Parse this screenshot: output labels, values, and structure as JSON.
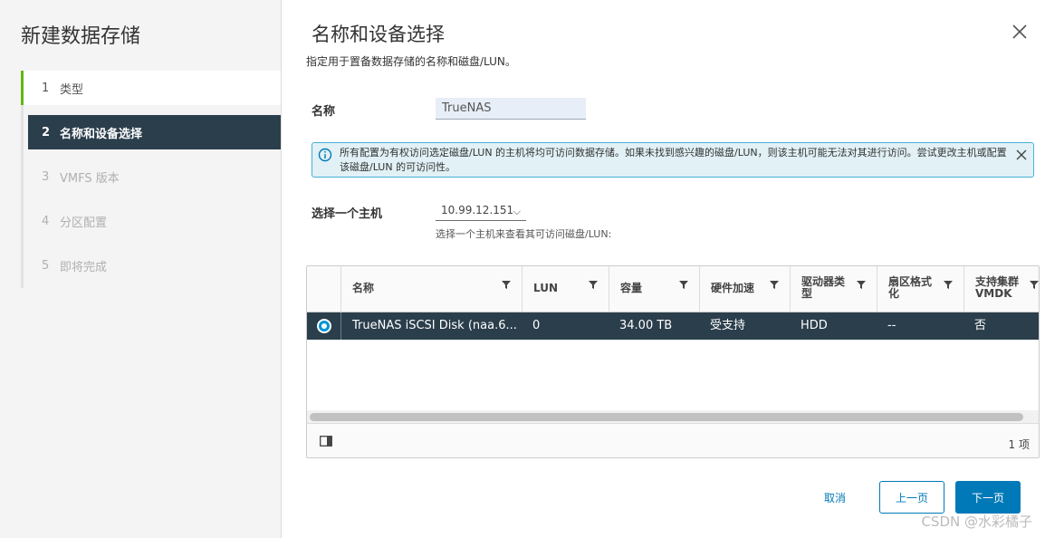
{
  "sidebar": {
    "title": "新建数据存储",
    "steps": [
      {
        "num": "1",
        "label": "类型"
      },
      {
        "num": "2",
        "label": "名称和设备选择"
      },
      {
        "num": "3",
        "label": "VMFS 版本"
      },
      {
        "num": "4",
        "label": "分区配置"
      },
      {
        "num": "5",
        "label": "即将完成"
      }
    ]
  },
  "page": {
    "title": "名称和设备选择",
    "subtitle": "指定用于置备数据存储的名称和磁盘/LUN。"
  },
  "name_field": {
    "label": "名称",
    "value": "TrueNAS"
  },
  "alert": {
    "text": "所有配置为有权访问选定磁盘/LUN 的主机将均可访问数据存储。如果未找到感兴趣的磁盘/LUN，则该主机可能无法对其进行访问。尝试更改主机或配置该磁盘/LUN 的可访问性。"
  },
  "host": {
    "label": "选择一个主机",
    "selected": "10.99.12.151",
    "hint": "选择一个主机来查看其可访问磁盘/LUN:"
  },
  "grid": {
    "columns": [
      "名称",
      "LUN",
      "容量",
      "硬件加速",
      "驱动器类型",
      "扇区格式化",
      "支持集群 VMDK"
    ],
    "column_lines": [
      [
        "名称"
      ],
      [
        "LUN"
      ],
      [
        "容量"
      ],
      [
        "硬件加速"
      ],
      [
        "驱动器类",
        "型"
      ],
      [
        "扇区格式",
        "化"
      ],
      [
        "支持集群",
        "VMDK"
      ]
    ],
    "rows": [
      {
        "name": "TrueNAS iSCSI Disk (naa.6...",
        "lun": "0",
        "capacity": "34.00 TB",
        "hw_accel": "受支持",
        "drive_type": "HDD",
        "sector_format": "--",
        "cluster_vmdk": "否",
        "selected": true
      }
    ],
    "footer_count": "1 项"
  },
  "buttons": {
    "cancel": "取消",
    "back": "上一页",
    "next": "下一页"
  },
  "watermark": "CSDN @水彩橘子",
  "colors": {
    "accent": "#0079b8",
    "selected_row": "#2b3e4c",
    "done_step": "#61b715",
    "alert_bg": "#e1f1f6",
    "alert_border": "#49afd9"
  },
  "icons": {
    "close": "close-icon",
    "info": "info-icon",
    "filter": "filter-icon",
    "column_toggle": "column-toggle-icon",
    "dropdown": "chevron-down-icon"
  }
}
